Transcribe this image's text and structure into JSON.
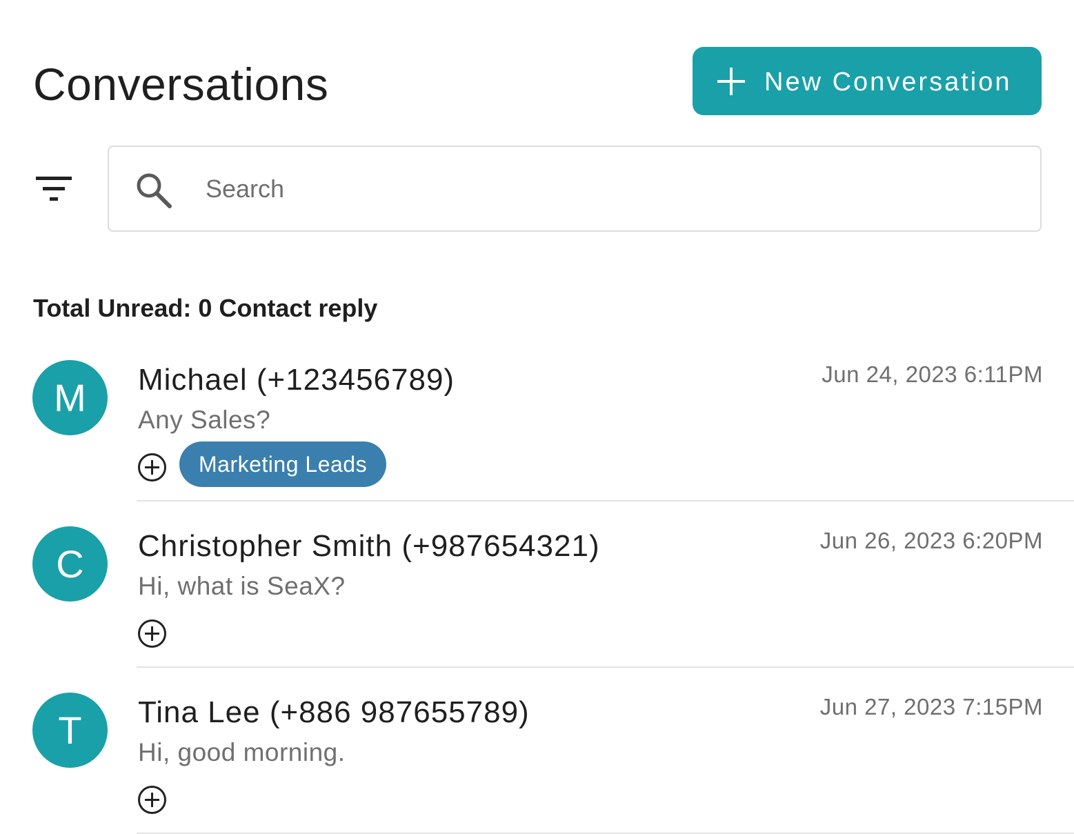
{
  "header": {
    "title": "Conversations",
    "new_button_label": "New Conversation"
  },
  "search": {
    "placeholder": "Search"
  },
  "summary": {
    "total_unread_text": "Total Unread: 0 Contact reply"
  },
  "conversations": [
    {
      "initial": "M",
      "name": "Michael (+123456789)",
      "message": "Any Sales?",
      "timestamp": "Jun 24, 2023 6:11PM",
      "tags": [
        "Marketing Leads"
      ]
    },
    {
      "initial": "C",
      "name": "Christopher Smith (+987654321)",
      "message": "Hi, what is SeaX?",
      "timestamp": "Jun 26, 2023 6:20PM",
      "tags": []
    },
    {
      "initial": "T",
      "name": "Tina Lee (+886 987655789)",
      "message": "Hi, good morning.",
      "timestamp": "Jun 27, 2023 7:15PM",
      "tags": []
    }
  ],
  "icons": {
    "new_button": "plus-icon",
    "filter": "filter-icon",
    "search": "search-icon",
    "add_tag": "add-circle-icon"
  },
  "colors": {
    "accent": "#1aa0a8",
    "tag": "#3a7fae",
    "muted_text": "#6f6f6f",
    "divider": "#e2e2e2"
  }
}
